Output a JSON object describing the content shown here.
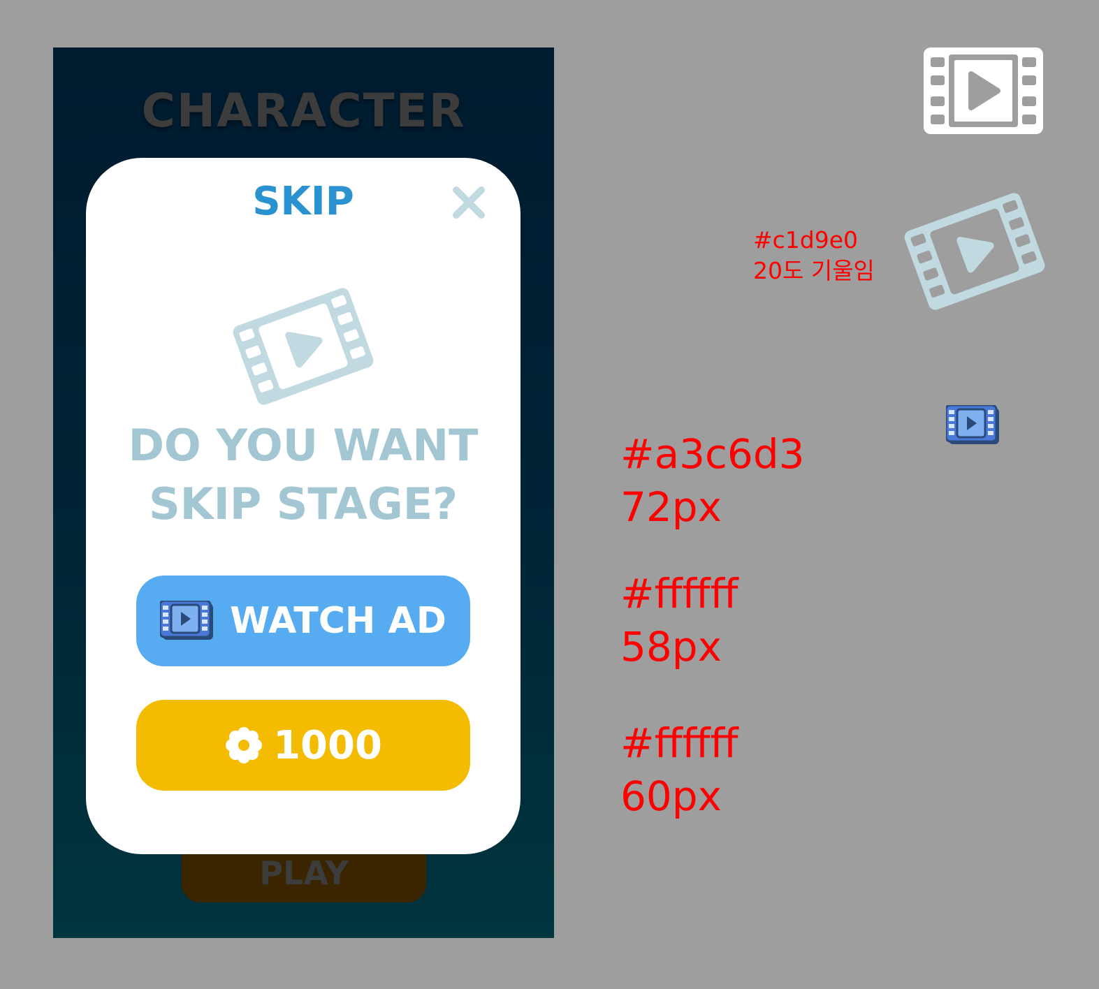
{
  "background": {
    "title": "CHARACTER",
    "play_label": "PLAY"
  },
  "modal": {
    "title": "SKIP",
    "question_line1": "DO YOU WANT",
    "question_line2": "SKIP STAGE?",
    "watch_ad_label": "WATCH AD",
    "coin_cost": "1000"
  },
  "annotations": {
    "film_color": "#c1d9e0",
    "film_tilt": "20도 기울임",
    "question_color": "#a3c6d3",
    "question_size": "72px",
    "watch_color": "#ffffff",
    "watch_size": "58px",
    "coin_color": "#ffffff",
    "coin_size": "60px"
  },
  "colors": {
    "modal_title": "#2a93cf",
    "watch_button": "#56abf1",
    "coin_button": "#f3bc00",
    "film_icon": "#c1d9e0",
    "question_text": "#a3c6d3"
  },
  "icons": [
    "close-icon",
    "film-icon",
    "play-icon",
    "gear-icon"
  ]
}
